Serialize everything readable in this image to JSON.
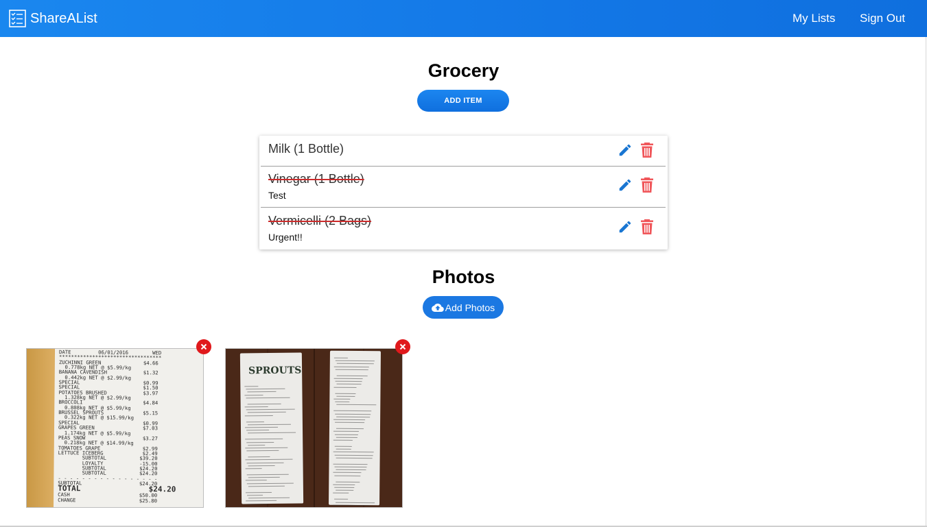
{
  "app": {
    "title": "ShareAList",
    "logo_icon": "checklist-icon"
  },
  "nav": {
    "my_lists": "My Lists",
    "sign_out": "Sign Out"
  },
  "list": {
    "title": "Grocery",
    "add_item_label": "ADD ITEM",
    "items": [
      {
        "name": "Milk (1 Bottle)",
        "note": "",
        "completed": false
      },
      {
        "name": "Vinegar (1 Bottle)",
        "note": "Test",
        "completed": true
      },
      {
        "name": "Vermicelli (2 Bags)",
        "note": "Urgent!!",
        "completed": true
      }
    ]
  },
  "photos": {
    "title": "Photos",
    "add_photos_label": "Add Photos",
    "add_photos_icon": "cloud-upload-icon",
    "items": [
      {
        "description": "grocery receipt photo"
      },
      {
        "description": "sprouts receipts photo"
      }
    ]
  },
  "receipt1": {
    "lines": [
      "DATE         06/01/2016        WED",
      "**********************************",
      "ZUCHINNI GREEN              $4.66",
      "  0.778kg NET @ $5.99/kg",
      "BANANA CAVENDISH            $1.32",
      "  0.442kg NET @ $2.99/kg",
      "SPECIAL                     $0.99",
      "SPECIAL                     $1.50",
      "POTATOES BRUSHED            $3.97",
      "  1.328kg NET @ $2.99/kg",
      "BROCCOLI                    $4.84",
      "  0.808kg NET @ $5.99/kg",
      "BRUSSEL SPROUTS             $5.15",
      "  0.322kg NET @ $15.99/kg",
      "SPECIAL                     $0.99",
      "GRAPES GREEN                $7.03",
      "  1.174kg NET @ $5.99/kg",
      "PEAS SNOW                   $3.27",
      "  0.218kg NET @ $14.99/kg",
      "TOMATOES GRAPE              $2.99",
      "LETTUCE ICEBERG             $2.49",
      "        SUBTOTAL           $39.20",
      "        LOYALTY            -15.00",
      "        SUBTOTAL           $24.20",
      "        SUBTOTAL           $24.20",
      "",
      "- - - - - - - - - - - - - - - - -",
      "SUBTOTAL                   $24.20"
    ],
    "total_label": "TOTAL",
    "total_value": "$24.20",
    "tail_lines": [
      "CASH                       $50.00",
      "CHANGE                     $25.80"
    ]
  },
  "receipt2": {
    "logo": "SPROUTS"
  },
  "colors": {
    "appbar": "#1377e6",
    "primary": "#1976d2",
    "delete": "#f0565a",
    "remove": "#e0191c"
  }
}
